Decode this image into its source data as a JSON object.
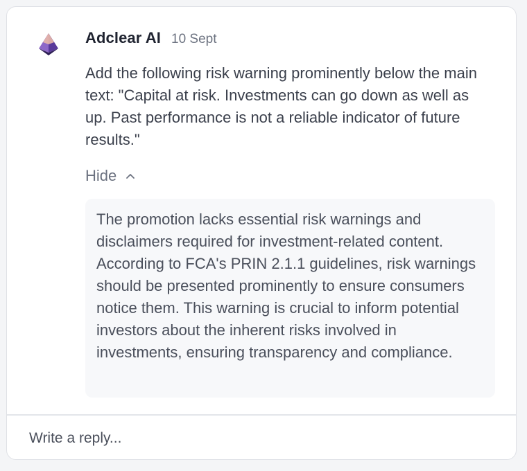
{
  "comment": {
    "author": "Adclear AI",
    "date": "10 Sept",
    "message": "Add the following risk warning prominently below the main text: \"Capital at risk. Investments can go down as well as up. Past performance is not a reliable indicator of future results.\"",
    "toggle_label": "Hide",
    "explanation": "The promotion lacks essential risk warnings and disclaimers required for investment-related content. According to FCA's PRIN 2.1.1 guidelines, risk warnings should be presented prominently to ensure consumers notice them. This warning is crucial to inform potential investors about the inherent risks involved in investments, ensuring transparency and compliance."
  },
  "reply": {
    "placeholder": "Write a reply...",
    "value": ""
  },
  "icons": {
    "avatar": "adclear-pyramid-logo-icon",
    "toggle": "chevron-up-icon"
  },
  "colors": {
    "logo_top": "#e9b8a8",
    "logo_left": "#8e68c8",
    "logo_right": "#5a3a9a",
    "logo_base": "#2e1f55"
  }
}
